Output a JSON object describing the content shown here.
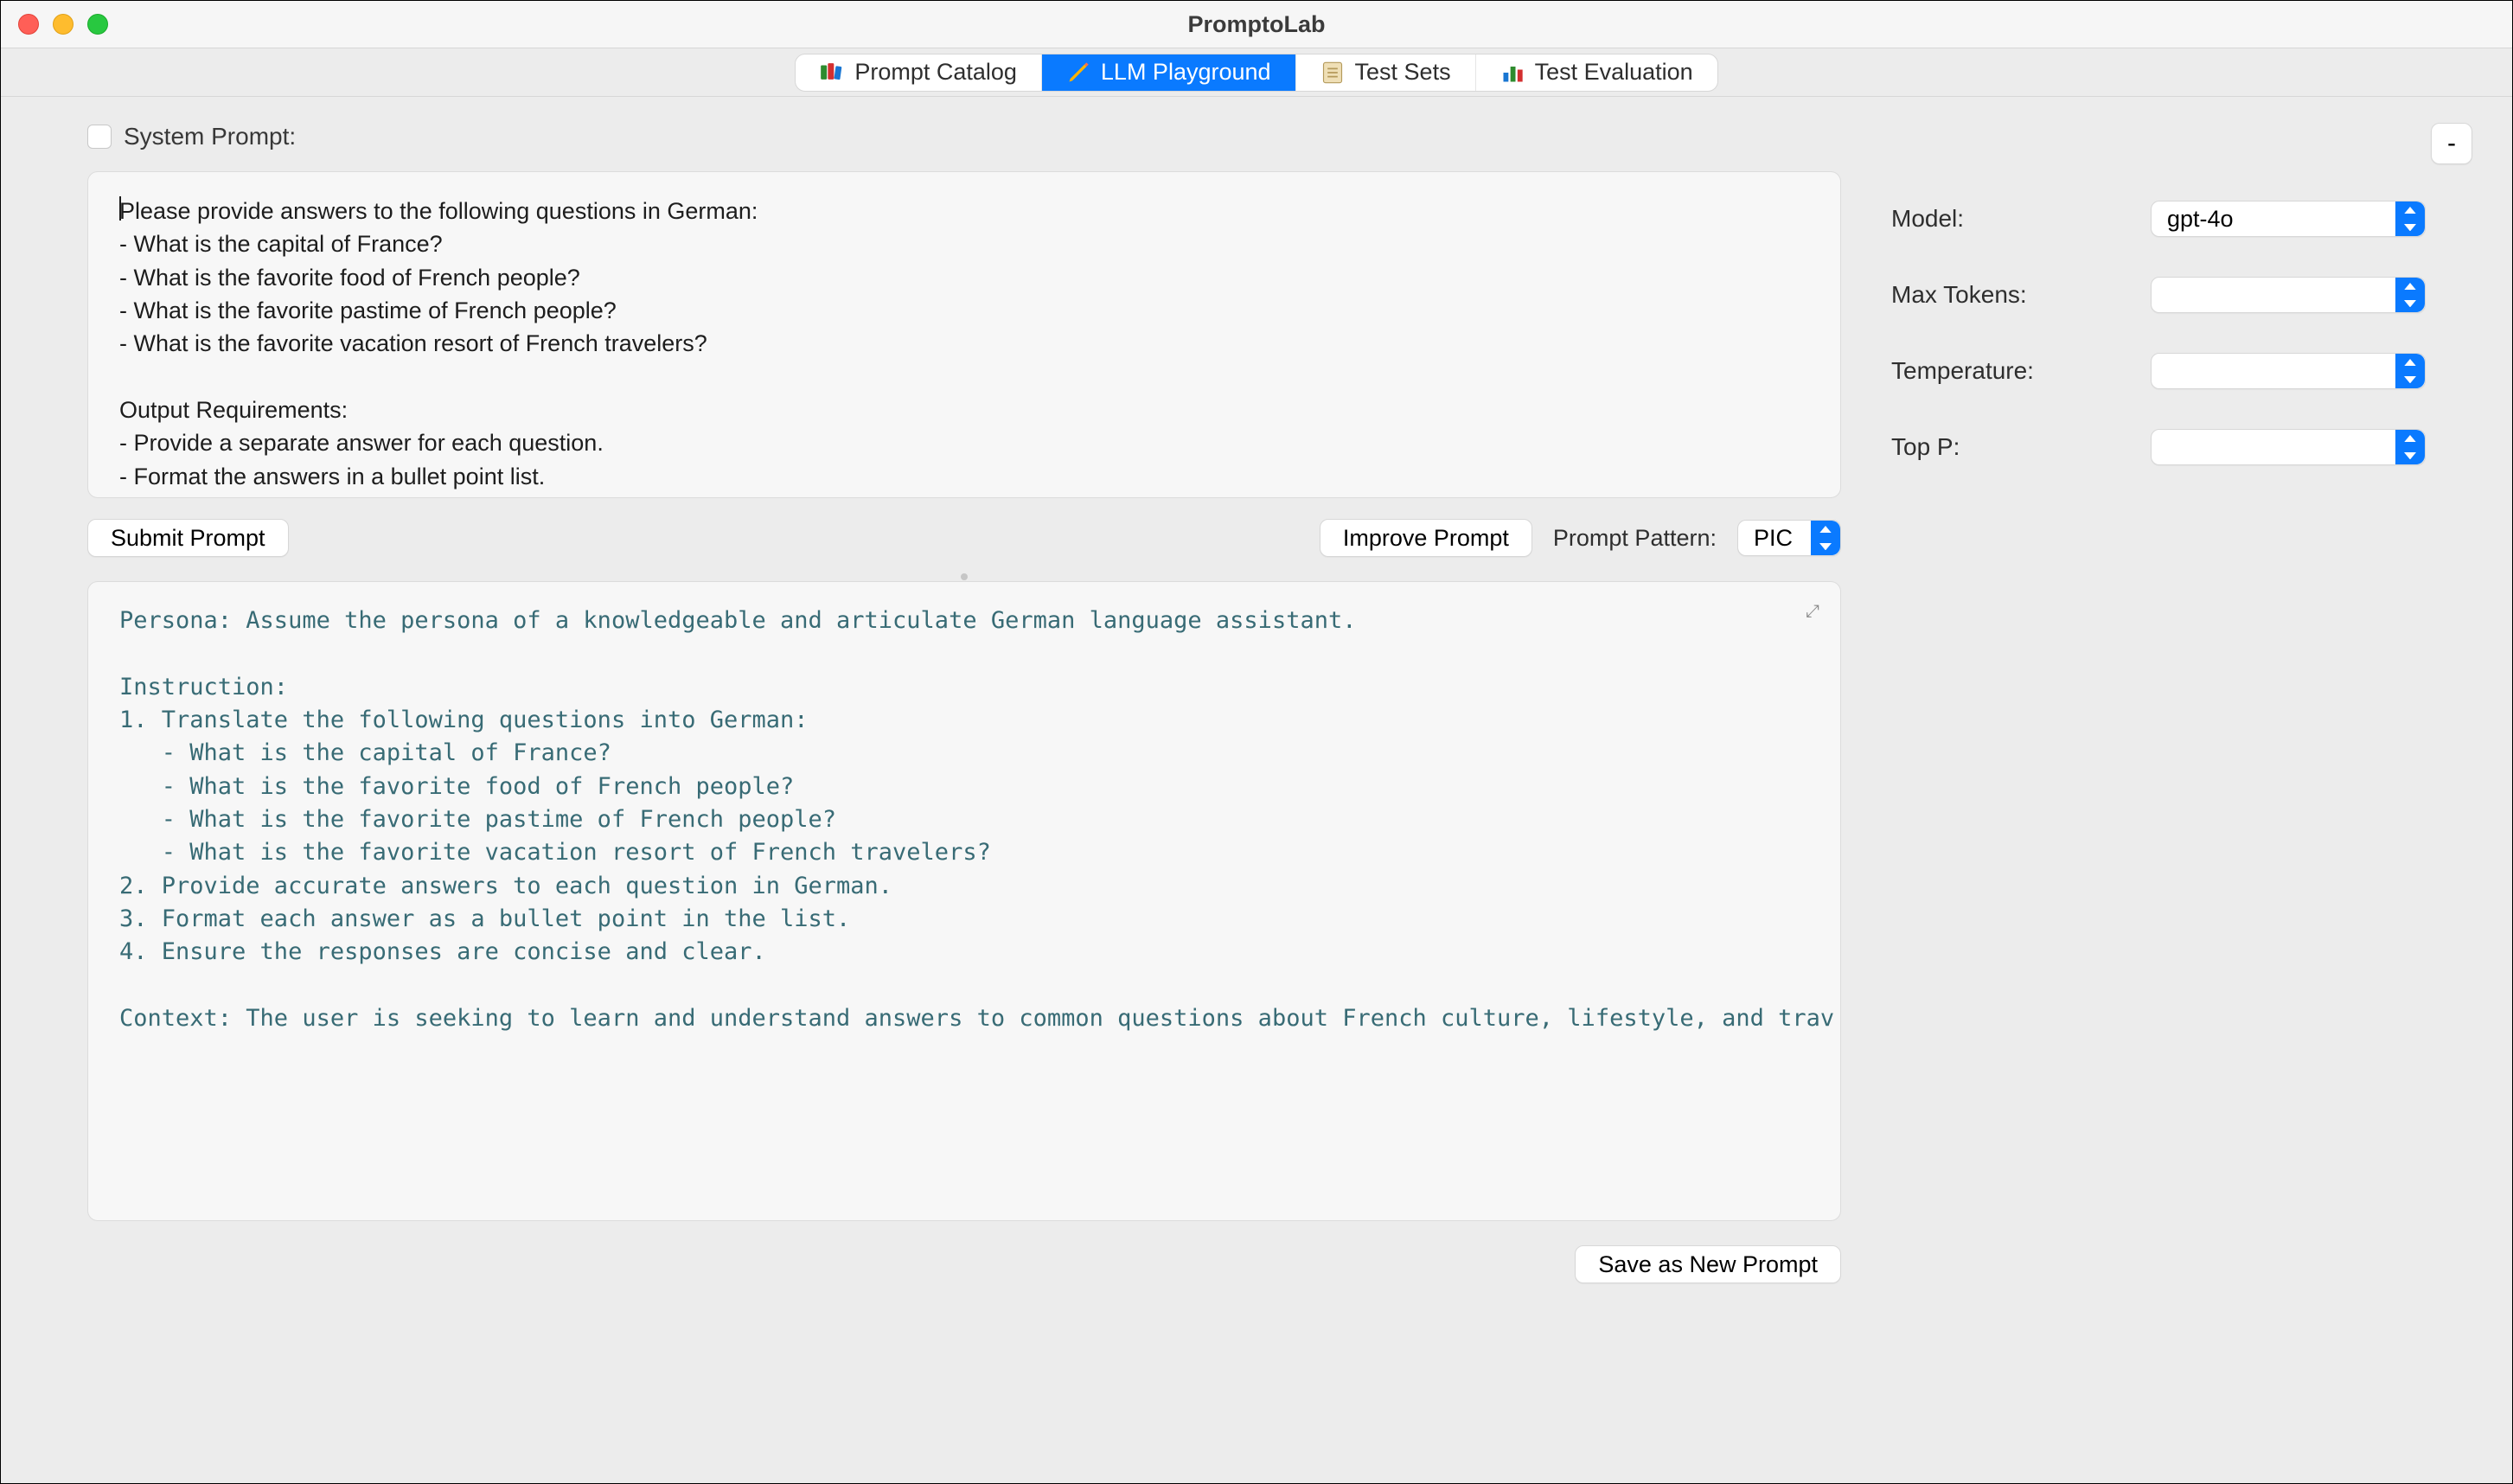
{
  "window": {
    "title": "PromptoLab"
  },
  "tabs": {
    "catalog": "Prompt Catalog",
    "playground": "LLM Playground",
    "testsets": "Test Sets",
    "evaluation": "Test Evaluation"
  },
  "corner_button": "-",
  "system_prompt_label": "System Prompt:",
  "prompt_text": "Please provide answers to the following questions in German:\n- What is the capital of France?\n- What is the favorite food of French people?\n- What is the favorite pastime of French people?\n- What is the favorite vacation resort of French travelers?\n\nOutput Requirements:\n- Provide a separate answer for each question.\n- Format the answers in a bullet point list.",
  "buttons": {
    "submit": "Submit Prompt",
    "improve": "Improve Prompt",
    "save_new": "Save as New Prompt"
  },
  "pattern": {
    "label": "Prompt Pattern:",
    "value": "PIC"
  },
  "output_text": "Persona: Assume the persona of a knowledgeable and articulate German language assistant.\n\nInstruction:\n1. Translate the following questions into German:\n   - What is the capital of France?\n   - What is the favorite food of French people?\n   - What is the favorite pastime of French people?\n   - What is the favorite vacation resort of French travelers?\n2. Provide accurate answers to each question in German.\n3. Format each answer as a bullet point in the list.\n4. Ensure the responses are concise and clear.\n\nContext: The user is seeking to learn and understand answers to common questions about French culture, lifestyle, and trav",
  "params": {
    "model_label": "Model:",
    "model_value": "gpt-4o",
    "max_tokens_label": "Max Tokens:",
    "max_tokens_value": "",
    "temperature_label": "Temperature:",
    "temperature_value": "",
    "top_p_label": "Top P:",
    "top_p_value": ""
  }
}
